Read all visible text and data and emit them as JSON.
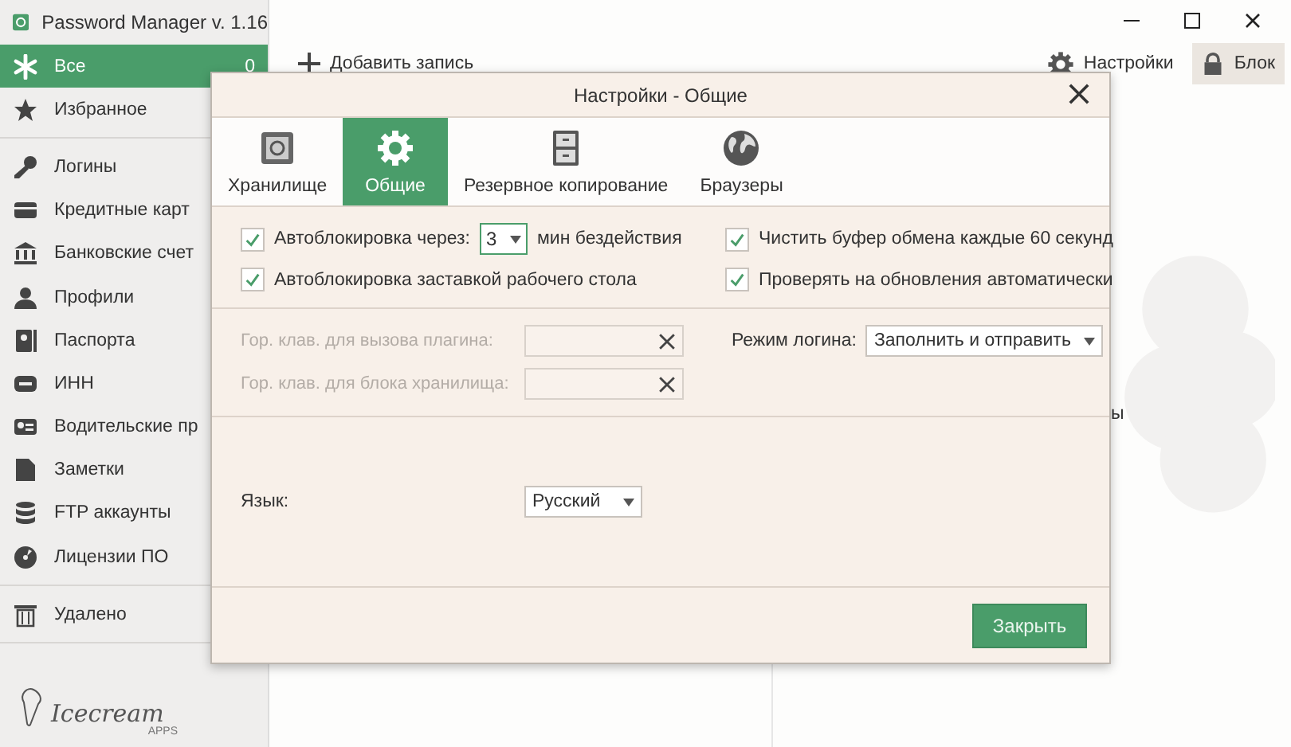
{
  "window": {
    "title": "Password Manager v. 1.16"
  },
  "sidebar": {
    "groups": [
      {
        "items": [
          {
            "label": "Все",
            "count": "0",
            "selected": true
          },
          {
            "label": "Избранное",
            "selected": false
          }
        ]
      },
      {
        "items": [
          {
            "label": "Логины",
            "selected": false
          },
          {
            "label": "Кредитные карт",
            "selected": false
          },
          {
            "label": "Банковские счет",
            "selected": false
          },
          {
            "label": "Профили",
            "selected": false
          },
          {
            "label": "Паспорта",
            "selected": false
          },
          {
            "label": "ИНН",
            "selected": false
          },
          {
            "label": "Водительские пр",
            "selected": false
          },
          {
            "label": "Заметки",
            "selected": false
          },
          {
            "label": "FTP аккаунты",
            "selected": false
          },
          {
            "label": "Лицензии ПО",
            "selected": false
          }
        ]
      },
      {
        "items": [
          {
            "label": "Удалено",
            "selected": false
          }
        ]
      }
    ],
    "logo": {
      "name": "Icecream",
      "sub": "APPS"
    }
  },
  "toolbar": {
    "add": "Добавить запись",
    "settings": "Настройки",
    "lock": "Блок"
  },
  "background_text": "ы",
  "dialog": {
    "title": "Настройки - Общие",
    "tabs": [
      {
        "label": "Хранилище",
        "selected": false
      },
      {
        "label": "Общие",
        "selected": true
      },
      {
        "label": "Резервное копирование",
        "selected": false
      },
      {
        "label": "Браузеры",
        "selected": false
      }
    ],
    "autolock": {
      "label": "Автоблокировка через:",
      "checked": true,
      "minutes": "3",
      "suffix": "мин бездействия"
    },
    "screensaver_lock": {
      "label": "Автоблокировка заставкой рабочего стола",
      "checked": true
    },
    "clear_clipboard": {
      "label": "Чистить буфер обмена каждые 60 секунд",
      "checked": true
    },
    "check_updates": {
      "label": "Проверять на обновления автоматически",
      "checked": true
    },
    "hotkeys": [
      {
        "label": "Гор. клав. для вызова плагина:",
        "disabled": true
      },
      {
        "label": "Гор. клав. для блока хранилища:",
        "disabled": true
      }
    ],
    "login_mode": {
      "label": "Режим логина:",
      "value": "Заполнить и отправить"
    },
    "language": {
      "label": "Язык:",
      "value": "Русский"
    },
    "close_button": "Закрыть"
  }
}
